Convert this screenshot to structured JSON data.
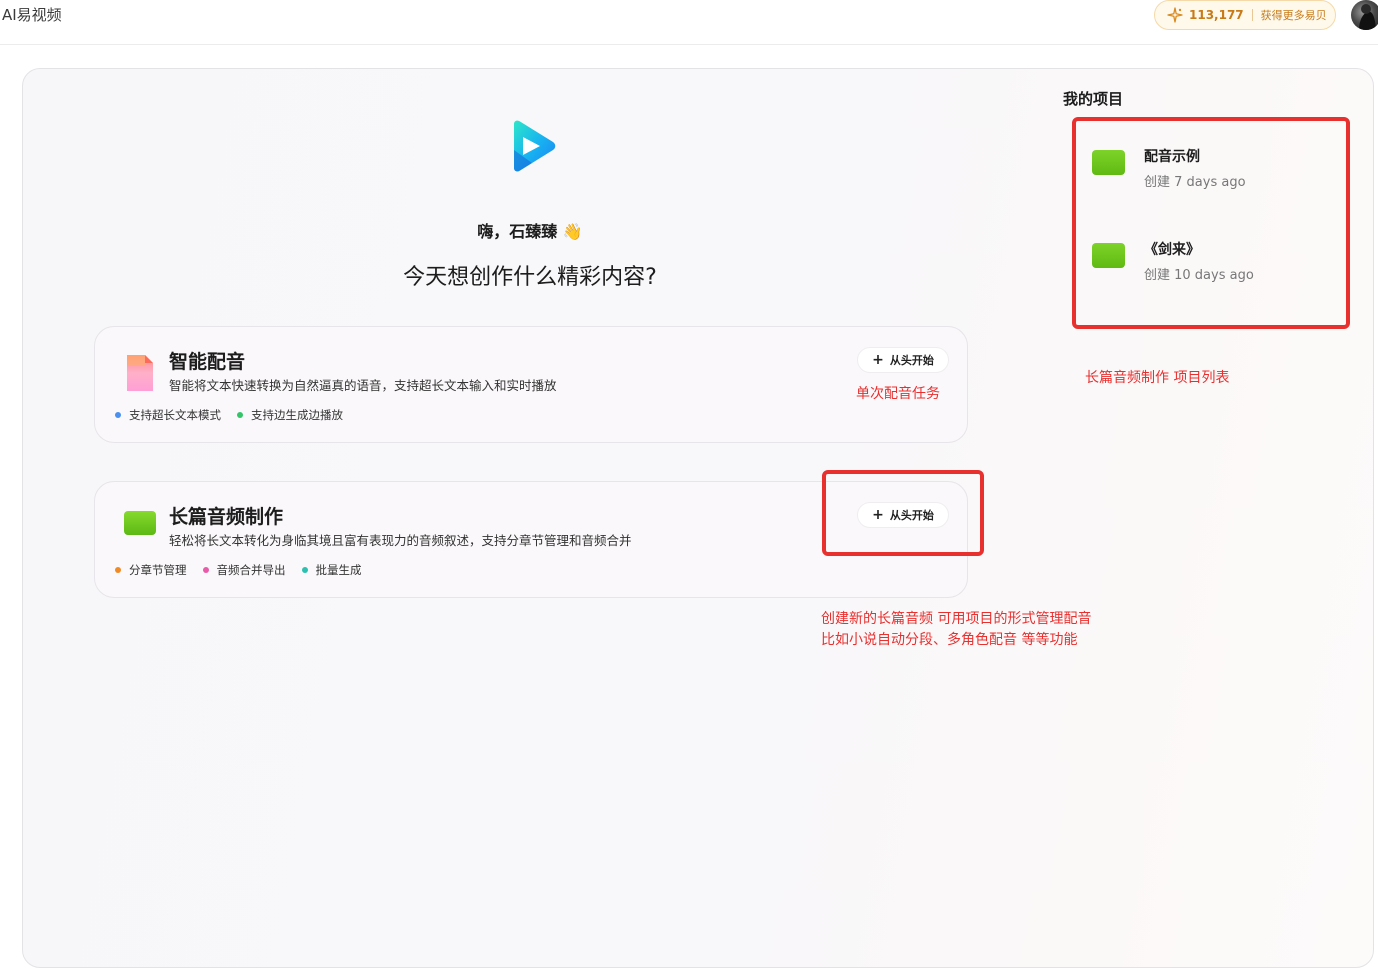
{
  "app": {
    "title": "AI易视频"
  },
  "header": {
    "credits_value": "113,177",
    "credits_action": "获得更多易贝",
    "accent": "#c77a18"
  },
  "main": {
    "greeting": "嗨，石臻臻 👋",
    "question": "今天想创作什么精彩内容?"
  },
  "cards": [
    {
      "title": "智能配音",
      "desc": "智能将文本快速转换为自然逼真的语音，支持超长文本输入和实时播放",
      "tags": [
        {
          "label": "支持超长文本模式",
          "color": "#4a90f0"
        },
        {
          "label": "支持边生成边播放",
          "color": "#34c46a"
        }
      ],
      "button": "从头开始",
      "icon": "document-icon"
    },
    {
      "title": "长篇音频制作",
      "desc": "轻松将长文本转化为身临其境且富有表现力的音频叙述，支持分章节管理和音频合并",
      "tags": [
        {
          "label": "分章节管理",
          "color": "#f08a24"
        },
        {
          "label": "音频合并导出",
          "color": "#e95ba8"
        },
        {
          "label": "批量生成",
          "color": "#2cc0b0"
        }
      ],
      "button": "从头开始",
      "icon": "green-folder-icon"
    }
  ],
  "projects": {
    "title": "我的项目",
    "items": [
      {
        "name": "配音示例",
        "meta": "创建 7 days ago"
      },
      {
        "name": "《剑来》",
        "meta": "创建 10 days ago"
      }
    ]
  },
  "annotations": {
    "single_task": "单次配音任务",
    "project_list": "长篇音频制作 项目列表",
    "create_line1": "创建新的长篇音频  可用项目的形式管理配音",
    "create_line2": "比如小说自动分段、多角色配音 等等功能",
    "color": "#e8302f"
  }
}
